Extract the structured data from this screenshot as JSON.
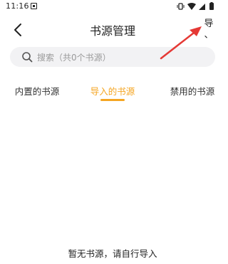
{
  "status_bar": {
    "time": "11:16",
    "icons": [
      "notification-icon",
      "vibrate-icon",
      "wifi-icon",
      "signal-icon",
      "battery-icon"
    ]
  },
  "header": {
    "title": "书源管理",
    "back_icon": "back-icon",
    "import_label": "导",
    "import_sub": "、"
  },
  "search": {
    "icon": "search-icon",
    "placeholder": "搜索（共0个书源）"
  },
  "tabs": [
    {
      "label": "内置的书源",
      "active": false
    },
    {
      "label": "导入的书源",
      "active": true
    },
    {
      "label": "禁用的书源",
      "active": false
    }
  ],
  "empty_state": {
    "message": "暂无书源，请自行导入"
  },
  "colors": {
    "accent": "#f5a623",
    "annotation_arrow": "#e53935",
    "search_bg": "#f2f2f4",
    "placeholder": "#9a9a9a"
  }
}
